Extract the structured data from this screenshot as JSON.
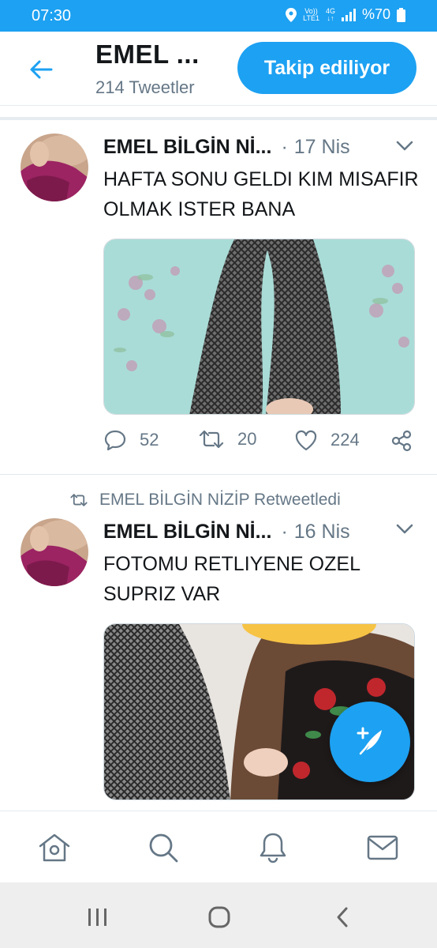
{
  "status_bar": {
    "time": "07:30",
    "volte_top": "Vo))",
    "volte_bottom": "LTE1",
    "network_top": "4G",
    "network_bottom": "↓↑",
    "battery": "%70"
  },
  "header": {
    "title": "EMEL ...",
    "subtitle": "214 Tweetler",
    "follow_label": "Takip ediliyor"
  },
  "tweets": [
    {
      "author": "EMEL BİLGİN Nİ...",
      "dot": "·",
      "date": "17 Nis",
      "text": "HAFTA SONU GELDI KIM MISAFIR OLMAK ISTER BANA",
      "replies": "52",
      "retweets": "20",
      "likes": "224"
    },
    {
      "retweet_label": "EMEL BİLGİN NİZİP Retweetledi",
      "author": "EMEL BİLGİN Nİ...",
      "dot": "·",
      "date": "16 Nis",
      "text": "FOTOMU RETLIYENE OZEL SUPRIZ VAR"
    }
  ],
  "colors": {
    "accent": "#1da1f2",
    "secondary_text": "#657786",
    "border": "#e6ecf0"
  },
  "icons": {
    "back": "arrow-left-icon",
    "caret": "chevron-down-icon",
    "reply": "reply-icon",
    "retweet": "retweet-icon",
    "like": "heart-icon",
    "share": "share-icon",
    "compose": "compose-feather-icon",
    "home": "home-icon",
    "search": "search-icon",
    "notifications": "bell-icon",
    "messages": "mail-icon"
  }
}
